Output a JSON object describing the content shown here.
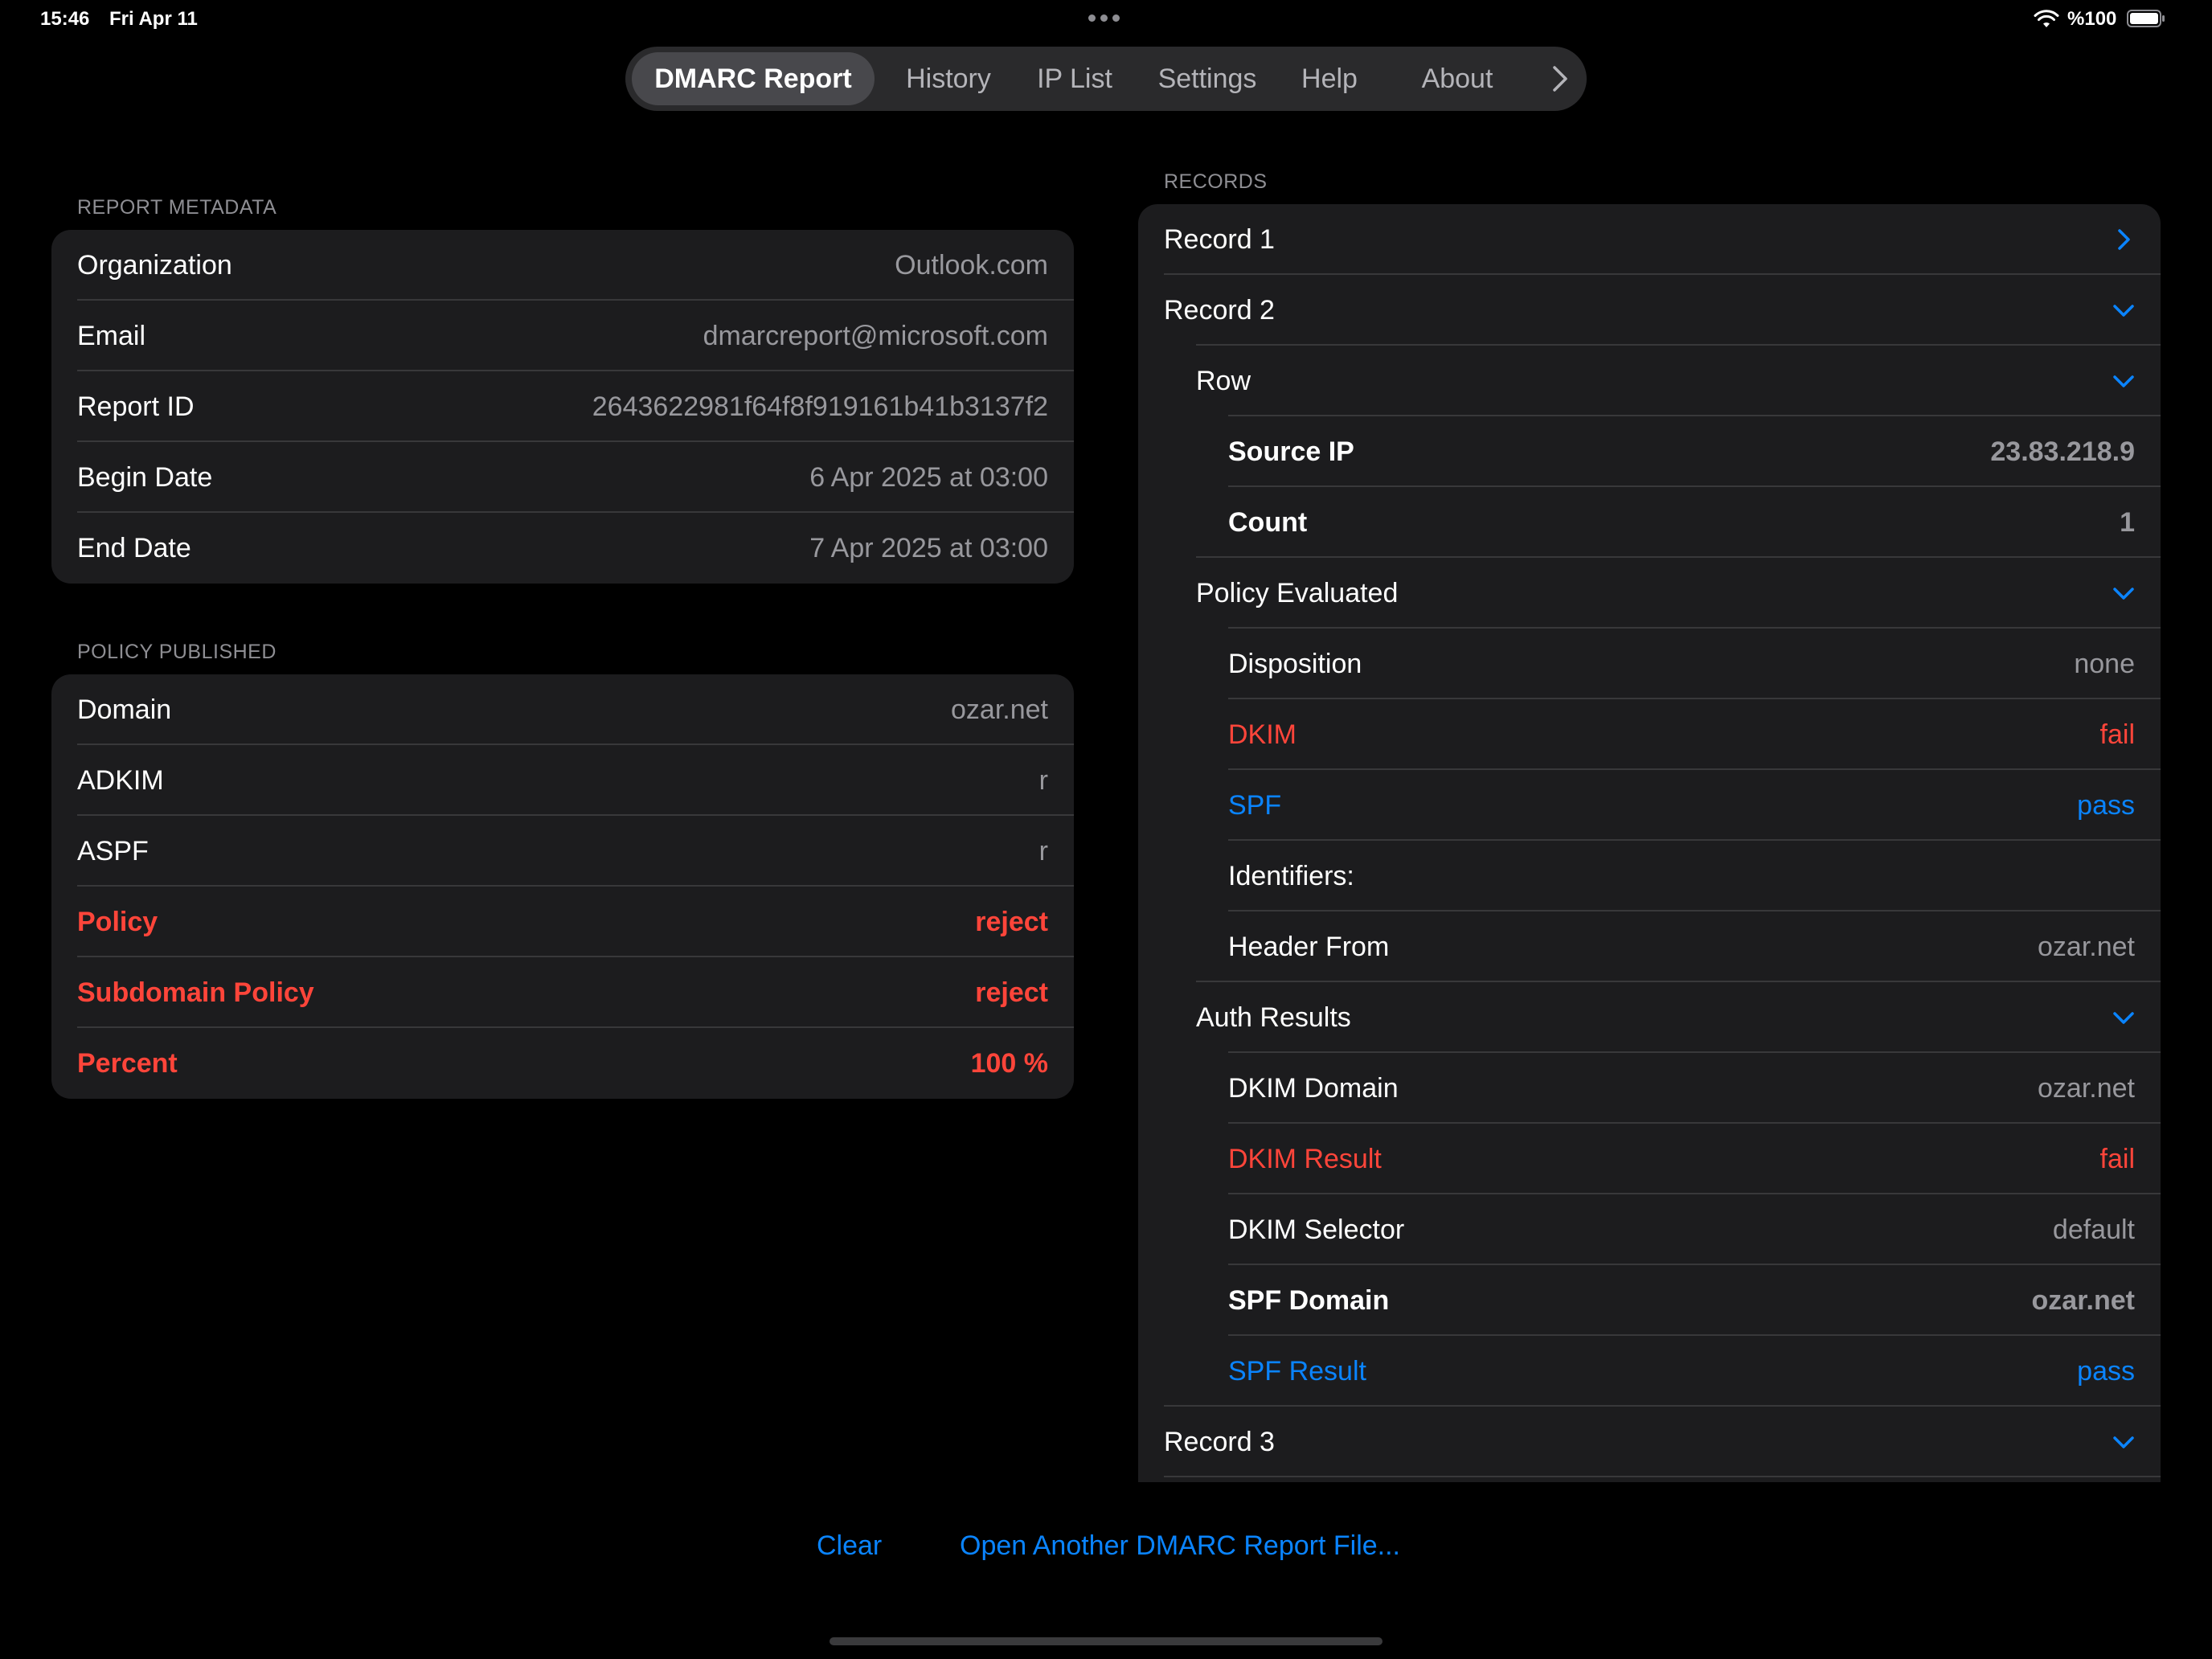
{
  "status": {
    "time": "15:46",
    "date": "Fri Apr 11",
    "battery": "%100",
    "wifi_icon": "wifi-icon",
    "battery_icon": "battery-icon"
  },
  "tabs": [
    {
      "label": "DMARC Report",
      "active": true
    },
    {
      "label": "History",
      "active": false
    },
    {
      "label": "IP List",
      "active": false
    },
    {
      "label": "Settings",
      "active": false
    },
    {
      "label": "Help",
      "active": false
    },
    {
      "label": "About",
      "active": false
    }
  ],
  "metadata": {
    "header": "REPORT METADATA",
    "rows": [
      {
        "label": "Organization",
        "value": "Outlook.com"
      },
      {
        "label": "Email",
        "value": "dmarcreport@microsoft.com"
      },
      {
        "label": "Report ID",
        "value": "2643622981f64f8f919161b41b3137f2"
      },
      {
        "label": "Begin Date",
        "value": "6 Apr 2025 at 03:00"
      },
      {
        "label": "End Date",
        "value": "7 Apr 2025 at 03:00"
      }
    ]
  },
  "policy": {
    "header": "POLICY PUBLISHED",
    "rows": [
      {
        "label": "Domain",
        "value": "ozar.net"
      },
      {
        "label": "ADKIM",
        "value": "r"
      },
      {
        "label": "ASPF",
        "value": "r"
      },
      {
        "label": "Policy",
        "value": "reject"
      },
      {
        "label": "Subdomain Policy",
        "value": "reject"
      },
      {
        "label": "Percent",
        "value": "100 %"
      }
    ]
  },
  "records": {
    "header": "RECORDS",
    "record1": "Record 1",
    "record2": "Record 2",
    "row": "Row",
    "source_ip_label": "Source IP",
    "source_ip_value": "23.83.218.9",
    "count_label": "Count",
    "count_value": "1",
    "policy_evaluated": "Policy Evaluated",
    "disposition_label": "Disposition",
    "disposition_value": "none",
    "dkim_label": "DKIM",
    "dkim_value": "fail",
    "spf_label": "SPF",
    "spf_value": "pass",
    "identifiers": "Identifiers:",
    "header_from_label": "Header From",
    "header_from_value": "ozar.net",
    "auth_results": "Auth Results",
    "dkim_domain_label": "DKIM Domain",
    "dkim_domain_value": "ozar.net",
    "dkim_result_label": "DKIM Result",
    "dkim_result_value": "fail",
    "dkim_selector_label": "DKIM Selector",
    "dkim_selector_value": "default",
    "spf_domain_label": "SPF Domain",
    "spf_domain_value": "ozar.net",
    "spf_result_label": "SPF Result",
    "spf_result_value": "pass",
    "record3": "Record 3"
  },
  "actions": {
    "clear": "Clear",
    "open_another": "Open Another DMARC Report File..."
  },
  "colors": {
    "accent": "#0a84ff",
    "fail": "#ff453a",
    "card": "#1c1c1e",
    "background": "#000000"
  }
}
